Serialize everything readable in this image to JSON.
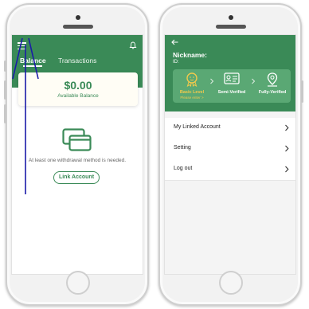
{
  "left_screen": {
    "tabs": [
      {
        "label": "Balance",
        "active": true
      },
      {
        "label": "Transactions",
        "active": false
      }
    ],
    "balance": {
      "amount": "$0.00",
      "label": "Available Balance"
    },
    "empty_message": "At least one withdrawal method is needed.",
    "link_button_label": "Link Account",
    "icons": [
      "menu-icon",
      "bell-icon",
      "cards-icon"
    ]
  },
  "right_screen": {
    "nickname_label": "Nickname:",
    "id_label": "ID:",
    "levels": [
      {
        "name": "Basic Level",
        "sub": "Please enter >",
        "icon": "face-badge-icon",
        "current": true
      },
      {
        "name": "Semi-Verified",
        "sub": "",
        "icon": "id-card-icon",
        "current": false
      },
      {
        "name": "Fully-Verified",
        "sub": "",
        "icon": "location-badge-icon",
        "current": false
      }
    ],
    "menu_items": [
      {
        "label": "My Linked Account"
      },
      {
        "label": "Setting"
      },
      {
        "label": "Log out"
      }
    ]
  },
  "colors": {
    "primary_green": "#3a8a57",
    "panel_green": "#5aa874",
    "accent_yellow": "#f2c94c",
    "annotation_arrow": "#1a1aa8"
  }
}
